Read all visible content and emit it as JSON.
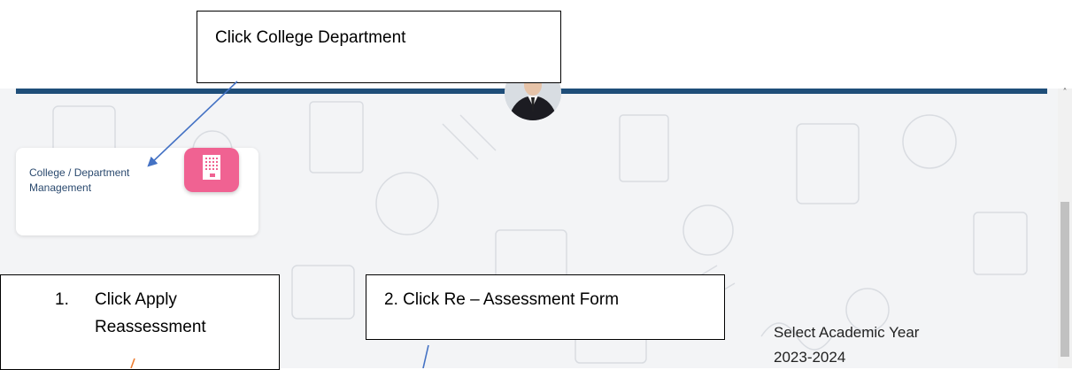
{
  "annotations": {
    "click_college_department": "Click College Department",
    "step1_number": "1.",
    "step1_line1": "Click Apply",
    "step1_line2": "Reassessment",
    "step2": "2. Click Re – Assessment Form"
  },
  "card": {
    "label_line1": "College / Department",
    "label_line2": "Management",
    "icon": "building-icon",
    "icon_color": "#f06292"
  },
  "academic_year": {
    "label": "Select Academic Year",
    "value": "2023-2024"
  },
  "scrollbar": {
    "up_glyph": "˄"
  },
  "colors": {
    "header_bar": "#1f4e79",
    "label_text": "#2b4a6f",
    "arrow_blue": "#4472c4",
    "arrow_orange": "#ed7d31"
  }
}
